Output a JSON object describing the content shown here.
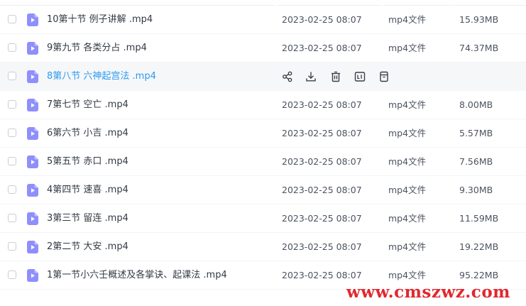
{
  "colors": {
    "name_text": "#333a45",
    "name_hover": "#2b9bf0",
    "meta_text": "#4b5260",
    "file_icon": "#8e8ffb",
    "row_hover_bg": "#f6f7f9",
    "watermark": "#e0282e"
  },
  "file_icon": "video-file-icon",
  "row_actions": [
    "share-icon",
    "download-icon",
    "delete-icon",
    "rename-icon",
    "more-icon"
  ],
  "files": [
    {
      "name": "10第十节 例子讲解 .mp4",
      "date": "2023-02-25 08:07",
      "type": "mp4文件",
      "size": "15.93MB"
    },
    {
      "name": "9第九节 各类分占 .mp4",
      "date": "2023-02-25 08:07",
      "type": "mp4文件",
      "size": "74.37MB"
    },
    {
      "name": "8第八节 六神起宫法 .mp4",
      "date": "",
      "type": "",
      "size": "",
      "hovered": true
    },
    {
      "name": "7第七节 空亡 .mp4",
      "date": "2023-02-25 08:07",
      "type": "mp4文件",
      "size": "8.00MB"
    },
    {
      "name": "6第六节 小吉 .mp4",
      "date": "2023-02-25 08:07",
      "type": "mp4文件",
      "size": "5.57MB"
    },
    {
      "name": "5第五节 赤口 .mp4",
      "date": "2023-02-25 08:07",
      "type": "mp4文件",
      "size": "7.56MB"
    },
    {
      "name": "4第四节 速喜 .mp4",
      "date": "2023-02-25 08:07",
      "type": "mp4文件",
      "size": "9.30MB"
    },
    {
      "name": "3第三节 留连 .mp4",
      "date": "2023-02-25 08:07",
      "type": "mp4文件",
      "size": "11.59MB"
    },
    {
      "name": "2第二节 大安 .mp4",
      "date": "2023-02-25 08:07",
      "type": "mp4文件",
      "size": "19.22MB"
    },
    {
      "name": "1第一节小六壬概述及各掌诀、起课法 .mp4",
      "date": "2023-02-25 08:07",
      "type": "mp4文件",
      "size": "95.22MB"
    }
  ],
  "watermark": "www.cmszwz.com"
}
